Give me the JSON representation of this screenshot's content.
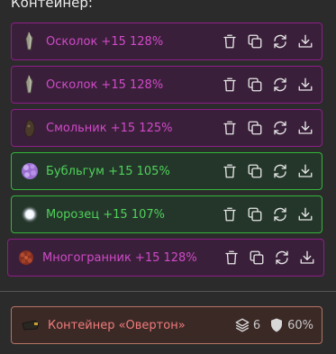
{
  "header": {
    "title": "Контейнер:"
  },
  "items": [
    {
      "label": "Осколок +15 128%",
      "icon": "shard-icon"
    },
    {
      "label": "Осколок +15 128%",
      "icon": "shard-icon"
    },
    {
      "label": "Смольник +15 125%",
      "icon": "tar-icon"
    },
    {
      "label": "Бубльгум +15 105%",
      "icon": "bubblegum-icon"
    },
    {
      "label": "Морозец +15 107%",
      "icon": "frost-icon"
    },
    {
      "label": "Многогранник +15 128%",
      "icon": "polyhedron-icon"
    }
  ],
  "actions": [
    "trash-icon",
    "copy-icon",
    "swap-icon",
    "download-icon"
  ],
  "container": {
    "label": "Контейнер «Овертон»",
    "icon": "container-icon",
    "slots": "6",
    "protection": "60%"
  },
  "colors": {
    "purple_border": "#8e1e8a",
    "purple_text": "#d04ac8",
    "green_border": "#35b53a",
    "green_text": "#4fd25a",
    "container_border": "#b57565",
    "container_text": "#f07c7c"
  }
}
